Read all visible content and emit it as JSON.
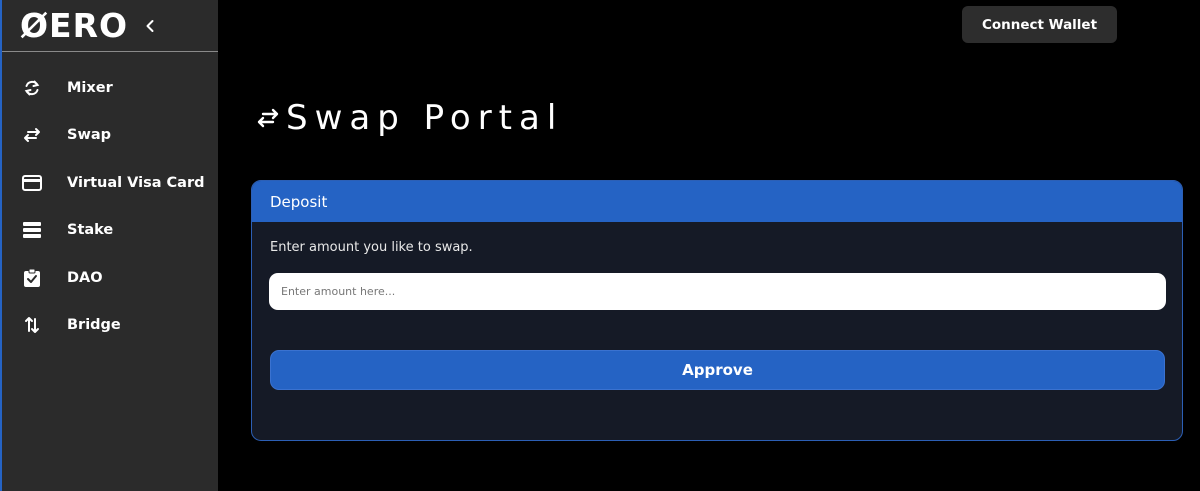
{
  "brand": {
    "logo_text": "ØERO"
  },
  "sidebar": {
    "items": [
      {
        "label": "Mixer",
        "icon": "sync-icon"
      },
      {
        "label": "Swap",
        "icon": "swap-horizontal-icon"
      },
      {
        "label": "Virtual Visa Card",
        "icon": "credit-card-icon"
      },
      {
        "label": "Stake",
        "icon": "stack-icon"
      },
      {
        "label": "DAO",
        "icon": "clipboard-check-icon"
      },
      {
        "label": "Bridge",
        "icon": "swap-vertical-icon"
      }
    ]
  },
  "header": {
    "connect_wallet_label": "Connect Wallet"
  },
  "main": {
    "title": "Swap Portal",
    "card": {
      "header": "Deposit",
      "description": "Enter amount you like to swap.",
      "amount_placeholder": "Enter amount here...",
      "approve_label": "Approve"
    }
  },
  "colors": {
    "accent": "#2563c4",
    "sidebar_bg": "#2b2b2b",
    "card_bg": "#151a26",
    "page_bg": "#000000"
  }
}
